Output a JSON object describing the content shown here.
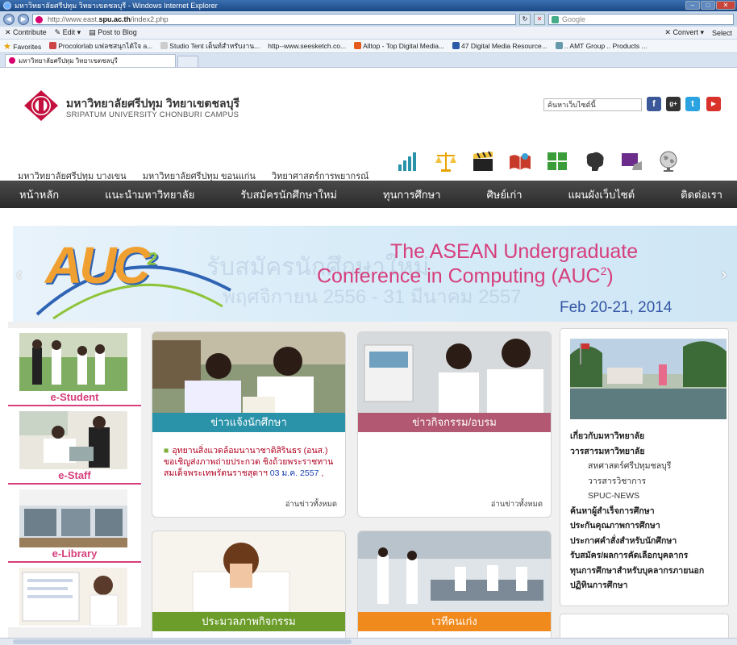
{
  "browser": {
    "title": "มหาวิทยาลัยศรีปทุม วิทยาเขตชลบุรี - Windows Internet Explorer",
    "url_prefix": "http://www.east.",
    "url_domain": "spu.ac.th",
    "url_path": "/index2.php",
    "search_placeholder": "Google",
    "command_items": [
      "Contribute",
      "Edit",
      "Post to Blog"
    ],
    "command_right": [
      "Convert",
      "Select"
    ],
    "favorites_label": "Favorites",
    "favorites": [
      "Procolorlab แฟลชสนุกได้ใจ a...",
      "Studio Tent เต็นท์สำหรับงาน...",
      "http--www.seesketch.co...",
      "Alltop - Top Digital Media...",
      "47 Digital Media Resource...",
      ".. AMT Group .. Products ..."
    ],
    "tab_title": "มหาวิทยาลัยศรีปทุม วิทยาเขตชลบุรี"
  },
  "site": {
    "brand_th": "มหาวิทยาลัยศรีปทุม วิทยาเขตชลบุรี",
    "brand_en": "SRIPATUM UNIVERSITY CHONBURI CAMPUS",
    "search_placeholder": "ค้นหาเว็บไซต์นี้",
    "sublinks": [
      "มหาวิทยาลัยศรีปทุม บางเขน",
      "มหาวิทยาลัยศรีปทุม ขอนแก่น",
      "วิทยาศาสตร์การพยากรณ์"
    ],
    "nav": [
      "หน้าหลัก",
      "แนะนำมหาวิทยาลัย",
      "รับสมัครนักศึกษาใหม่",
      "ทุนการศึกษา",
      "ศิษย์เก่า",
      "แผนผังเว็บไซต์",
      "ติดต่อเรา"
    ],
    "banner": {
      "line1": "The ASEAN Undergraduate",
      "line2": "Conference in Computing (AUC",
      "line2_sup": "2",
      "line2_end": ")",
      "date": "Feb 20-21, 2014",
      "ghost1": "รับสมัครนักศึกษาใหม่",
      "ghost2": "พฤศจิกายน 2556 - 31 มีนาคม 2557",
      "logo": "AUC",
      "logo_sup": "2"
    },
    "left_blocks": [
      "e-Student",
      "e-Staff",
      "e-Library"
    ],
    "cards": {
      "student_news": "ข่าวแจ้งนักศึกษา",
      "activity_news": "ข่าวกิจกรรม/อบรม",
      "gallery": "ประมวลภาพกิจกรรม",
      "alumni": "เวทีคนเก่ง",
      "read_all": "อ่านข่าวทั้งหมด",
      "news_item": "อุทยานสิ่งแวดล้อมนานาชาติสิรินธร (อนส.) ขอเชิญส่งภาพถ่ายประกวด ชิงถ้วยพระราชทานสมเด็จพระเทพรัตนราชสุดาฯ",
      "news_date": "03 ม.ค. 2557",
      "news_comma": ","
    },
    "right_links": [
      {
        "text": "เกี่ยวกับมหาวิทยาลัย",
        "indent": false
      },
      {
        "text": "วารสารมหาวิทยาลัย",
        "indent": false
      },
      {
        "text": "สหศาสตร์ศรีปทุมชลบุรี",
        "indent": true
      },
      {
        "text": "วารสารวิชาการ",
        "indent": true
      },
      {
        "text": "SPUC-NEWS",
        "indent": true
      },
      {
        "text": "ค้นหาผู้สำเร็จการศึกษา",
        "indent": false
      },
      {
        "text": "ประกันคุณภาพการศึกษา",
        "indent": false
      },
      {
        "text": "ประกาศคำสั่งสำหรับนักศึกษา",
        "indent": false
      },
      {
        "text": "รับสมัคร/ผลการคัดเลือกบุคลากร",
        "indent": false
      },
      {
        "text": "ทุนการศึกษาสำหรับบุคลากรภายนอก",
        "indent": false
      },
      {
        "text": "ปฏิทินการศึกษา",
        "indent": false
      }
    ]
  },
  "colors": {
    "accent": "#d63e7c",
    "nav_bg": "#333333",
    "teal": "#2a93a9",
    "rose": "#b25872",
    "green": "#6c9d2b",
    "orange": "#f08a1c"
  }
}
